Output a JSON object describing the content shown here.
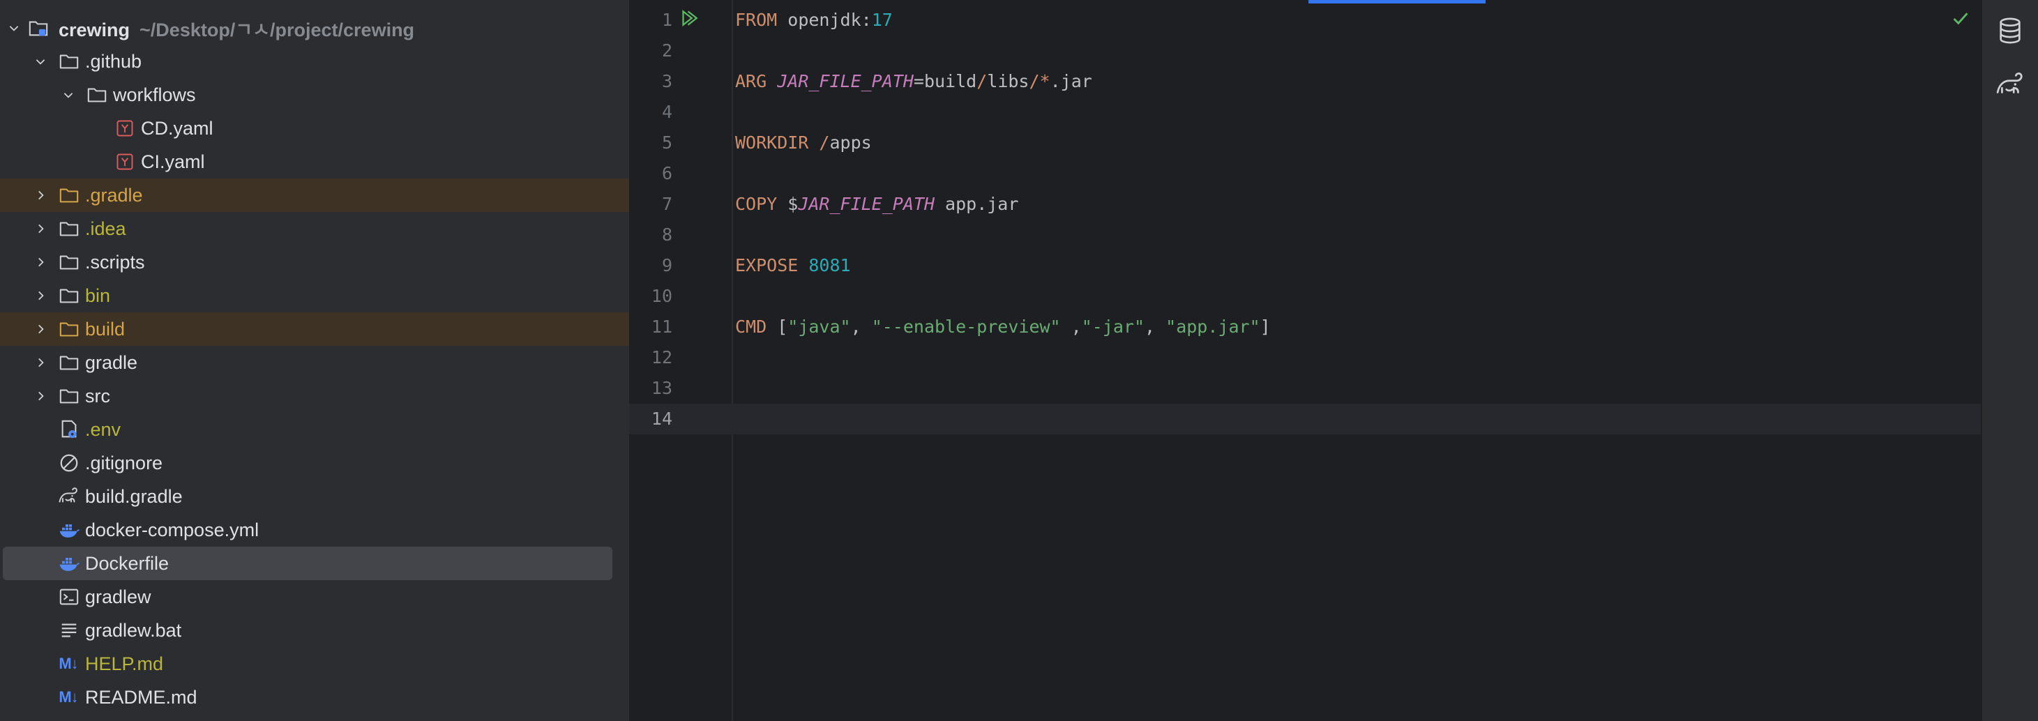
{
  "project_tree": {
    "root": {
      "name": "crewing",
      "path": "~/Desktop/ㄱㅅ/project/crewing"
    },
    "items": [
      {
        "name": ".github",
        "type": "folder",
        "depth": 1,
        "expanded": true,
        "icon": "folder-icon"
      },
      {
        "name": "workflows",
        "type": "folder",
        "depth": 2,
        "expanded": true,
        "icon": "folder-icon"
      },
      {
        "name": "CD.yaml",
        "type": "file",
        "depth": 3,
        "icon": "yaml-file-icon"
      },
      {
        "name": "CI.yaml",
        "type": "file",
        "depth": 3,
        "icon": "yaml-file-icon"
      },
      {
        "name": ".gradle",
        "type": "folder",
        "depth": 1,
        "expanded": false,
        "status": "excluded",
        "icon": "folder-icon"
      },
      {
        "name": ".idea",
        "type": "folder",
        "depth": 1,
        "expanded": false,
        "status": "ignored",
        "icon": "folder-icon"
      },
      {
        "name": ".scripts",
        "type": "folder",
        "depth": 1,
        "expanded": false,
        "icon": "folder-icon"
      },
      {
        "name": "bin",
        "type": "folder",
        "depth": 1,
        "expanded": false,
        "status": "ignored",
        "icon": "folder-icon"
      },
      {
        "name": "build",
        "type": "folder",
        "depth": 1,
        "expanded": false,
        "status": "excluded",
        "icon": "folder-icon"
      },
      {
        "name": "gradle",
        "type": "folder",
        "depth": 1,
        "expanded": false,
        "icon": "folder-icon"
      },
      {
        "name": "src",
        "type": "folder",
        "depth": 1,
        "expanded": false,
        "icon": "folder-icon"
      },
      {
        "name": ".env",
        "type": "file",
        "depth": 1,
        "status": "ignored",
        "icon": "env-file-icon"
      },
      {
        "name": ".gitignore",
        "type": "file",
        "depth": 1,
        "icon": "gitignore-icon"
      },
      {
        "name": "build.gradle",
        "type": "file",
        "depth": 1,
        "icon": "gradle-elephant-icon"
      },
      {
        "name": "docker-compose.yml",
        "type": "file",
        "depth": 1,
        "icon": "docker-icon"
      },
      {
        "name": "Dockerfile",
        "type": "file",
        "depth": 1,
        "selected": true,
        "icon": "docker-icon"
      },
      {
        "name": "gradlew",
        "type": "file",
        "depth": 1,
        "icon": "terminal-icon"
      },
      {
        "name": "gradlew.bat",
        "type": "file",
        "depth": 1,
        "icon": "text-lines-icon"
      },
      {
        "name": "HELP.md",
        "type": "file",
        "depth": 1,
        "status": "ignored",
        "icon": "markdown-icon"
      },
      {
        "name": "README.md",
        "type": "file",
        "depth": 1,
        "icon": "markdown-icon"
      }
    ],
    "markdown_badge": "M↓"
  },
  "editor": {
    "file": "Dockerfile",
    "current_line": 14,
    "status_icon": "check-icon",
    "lines": [
      [
        [
          "kw",
          "FROM"
        ],
        [
          "t",
          " openjdk:"
        ],
        [
          "num",
          "17"
        ]
      ],
      [],
      [
        [
          "kw",
          "ARG"
        ],
        [
          "t",
          " "
        ],
        [
          "var",
          "JAR_FILE_PATH"
        ],
        [
          "t",
          "=build"
        ],
        [
          "opx",
          "/"
        ],
        [
          "t",
          "libs"
        ],
        [
          "opx",
          "/*"
        ],
        [
          "t",
          ".jar"
        ]
      ],
      [],
      [
        [
          "kw",
          "WORKDIR"
        ],
        [
          "t",
          " "
        ],
        [
          "opx",
          "/"
        ],
        [
          "t",
          "apps"
        ]
      ],
      [],
      [
        [
          "kw",
          "COPY"
        ],
        [
          "t",
          " $"
        ],
        [
          "var",
          "JAR_FILE_PATH"
        ],
        [
          "t",
          " app.jar"
        ]
      ],
      [],
      [
        [
          "kw",
          "EXPOSE"
        ],
        [
          "t",
          " "
        ],
        [
          "num",
          "8081"
        ]
      ],
      [],
      [
        [
          "kw",
          "CMD"
        ],
        [
          "t",
          " ["
        ],
        [
          "str",
          "\"java\""
        ],
        [
          "t",
          ", "
        ],
        [
          "str",
          "\"--enable-preview\""
        ],
        [
          "t",
          " ,"
        ],
        [
          "str",
          "\"-jar\""
        ],
        [
          "t",
          ", "
        ],
        [
          "str",
          "\"app.jar\""
        ],
        [
          "t",
          "]"
        ]
      ],
      [],
      [],
      []
    ]
  },
  "right_toolbar": [
    {
      "icon": "database-icon"
    },
    {
      "icon": "gradle-elephant-icon"
    }
  ],
  "colors": {
    "accent": "#3574f0",
    "excluded_bg": "#3d3223",
    "ignored_text": "#b9b63a",
    "excluded_text": "#d5a54b",
    "selected_bg": "#43454a"
  }
}
